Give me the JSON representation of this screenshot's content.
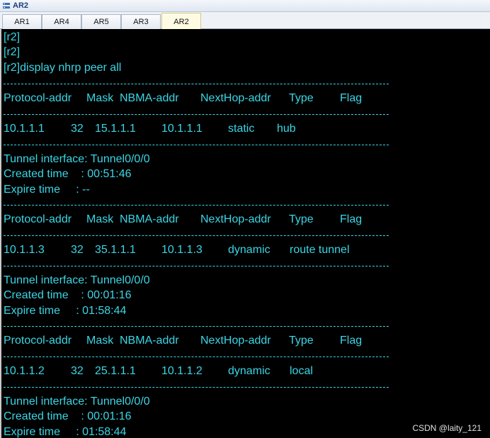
{
  "window": {
    "title": "AR2"
  },
  "tabs": [
    {
      "label": "AR1",
      "active": false
    },
    {
      "label": "AR4",
      "active": false
    },
    {
      "label": "AR5",
      "active": false
    },
    {
      "label": "AR3",
      "active": false
    },
    {
      "label": "AR2",
      "active": true
    }
  ],
  "terminal": {
    "prompt_lines": [
      "[r2]",
      "[r2]",
      "[r2]display nhrp peer all"
    ],
    "separator_text": "--------------------------------------------------------------------------------",
    "header": {
      "protocol": "Protocol-addr",
      "mask": "Mask",
      "nbma": "NBMA-addr",
      "nexthop": "NextHop-addr",
      "type": "Type",
      "flag": "Flag"
    },
    "peers": [
      {
        "protocol": "10.1.1.1",
        "mask": "32",
        "nbma": "15.1.1.1",
        "nexthop": "10.1.1.1",
        "type": "static",
        "flag": "hub",
        "tunnel": "Tunnel interface: Tunnel0/0/0",
        "created": "Created time    : 00:51:46",
        "expire": "Expire time     : --"
      },
      {
        "protocol": "10.1.1.3",
        "mask": "32",
        "nbma": "35.1.1.1",
        "nexthop": "10.1.1.3",
        "type": "dynamic",
        "flag": "route tunnel",
        "tunnel": "Tunnel interface: Tunnel0/0/0",
        "created": "Created time    : 00:01:16",
        "expire": "Expire time     : 01:58:44"
      },
      {
        "protocol": "10.1.1.2",
        "mask": "32",
        "nbma": "25.1.1.1",
        "nexthop": "10.1.1.2",
        "type": "dynamic",
        "flag": "local",
        "tunnel": "Tunnel interface: Tunnel0/0/0",
        "created": "Created time    : 00:01:16",
        "expire": "Expire time     : 01:58:44"
      }
    ]
  },
  "watermark": "CSDN @laity_121",
  "colors": {
    "terminal_text": "#3ad6e6",
    "terminal_bg": "#000000"
  }
}
